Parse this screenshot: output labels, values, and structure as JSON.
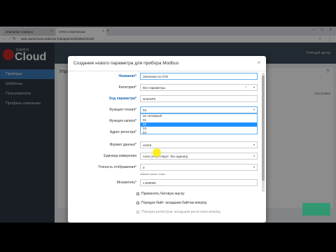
{
  "browser": {
    "tabs": [
      {
        "label": "Описание сервиса",
        "active": false
      },
      {
        "label": "СПК в OwenCloud",
        "active": true
      }
    ],
    "url": "web.owencloud.ru/device-management/index/10445",
    "window_controls": [
      "–",
      "□",
      "×"
    ]
  },
  "app": {
    "logo": {
      "brand_top": "owen",
      "brand_main": "Cloud"
    },
    "sidebar": {
      "items": [
        {
          "label": "Приборы",
          "active": true
        },
        {
          "label": "Шаблоны",
          "active": false
        },
        {
          "label": "Пользователи",
          "active": false
        },
        {
          "label": "Профиль компании",
          "active": false
        }
      ]
    },
    "topbar": {
      "user_label": "Учётный центр"
    },
    "page_title": "Управ",
    "settings_label": "Настройки"
  },
  "modal": {
    "title": "Создание нового параметра для прибора Modbus",
    "close": "×",
    "fields": [
      {
        "label": "Название*",
        "value": "Значение из СПК",
        "label_style": "blue"
      },
      {
        "label": "Категория*",
        "value": "Все параметры",
        "label_style": "normal"
      },
      {
        "label": "Код параметра*",
        "value": "writeSPK",
        "label_style": "blue"
      },
      {
        "label": "Функция чтения*",
        "value": "03",
        "label_style": "normal"
      },
      {
        "label": "Функция записи*",
        "value": "",
        "label_style": "normal"
      },
      {
        "label": "Адрес регистра*",
        "value": "",
        "label_style": "normal"
      },
      {
        "label": "Формат данных*",
        "value": "uint16",
        "label_style": "normal"
      },
      {
        "label": "Единица измерения",
        "value": "none (отсутствует: без единиц)",
        "label_style": "normal"
      },
      {
        "label": "Точность отображения*",
        "value": "0",
        "label_style": "normal"
      },
      {
        "label": "Множитель*",
        "value": "1.000000",
        "label_style": "normal"
      }
    ],
    "dropdown_options": [
      {
        "label": "не читаемый",
        "selected": false
      },
      {
        "label": "01",
        "selected": false
      },
      {
        "label": "02",
        "selected": true
      },
      {
        "label": "03",
        "selected": false
      },
      {
        "label": "04",
        "selected": false
      }
    ],
    "precision_hint": "знаков после точки",
    "checkboxes": [
      {
        "label": "Применять битовую маску"
      },
      {
        "label": "Порядок байт: младшим байтом вперёд"
      },
      {
        "label": "Порядок регистров: младшим регистром вперёд"
      }
    ]
  },
  "colors": {
    "accent": "#3d7ab8",
    "label_blue": "#1e6ab3",
    "sidebar_bg": "#2d3742",
    "selected_option": "#1e90ff"
  }
}
